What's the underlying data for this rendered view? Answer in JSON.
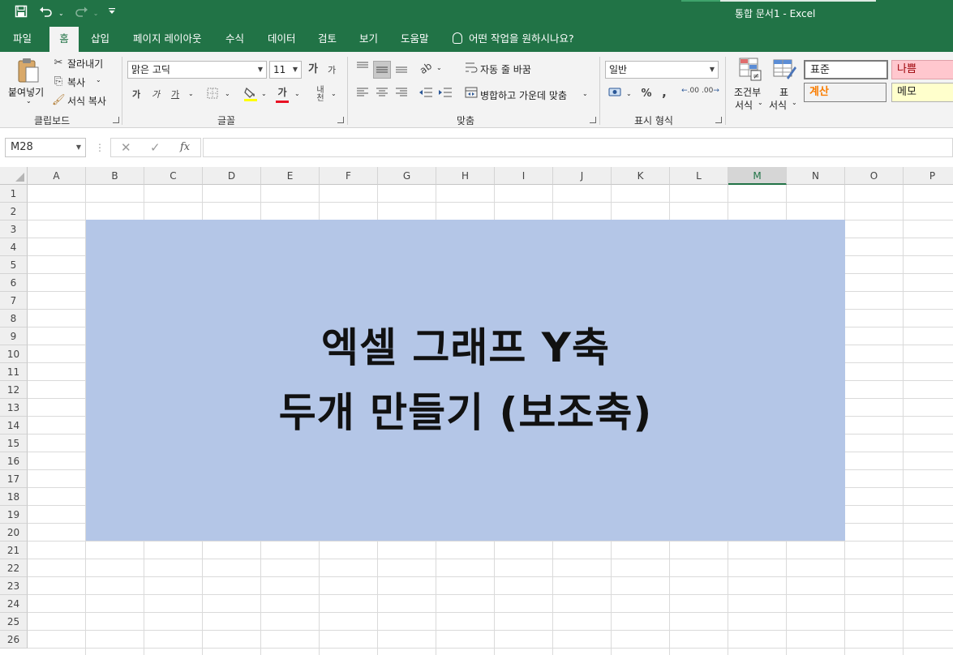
{
  "titlebar": {
    "title": "통합 문서1  -  Excel",
    "qat": {
      "save_icon": "save-icon",
      "undo_icon": "undo-icon",
      "redo_icon": "redo-icon",
      "customize_icon": "customize-qat-icon"
    }
  },
  "tabs": [
    "파일",
    "홈",
    "삽입",
    "페이지 레이아웃",
    "수식",
    "데이터",
    "검토",
    "보기",
    "도움말"
  ],
  "active_tab": "홈",
  "tell_me": "어떤 작업을 원하시나요?",
  "ribbon": {
    "clipboard": {
      "label": "클립보드",
      "paste": "붙여넣기",
      "cut": "잘라내기",
      "copy": "복사",
      "format_painter": "서식 복사"
    },
    "font": {
      "label": "글꼴",
      "font_name": "맑은 고딕",
      "font_size": "11",
      "grow": "가",
      "shrink": "가",
      "bold": "가",
      "italic": "가",
      "underline": "가",
      "font_color_letter": "가",
      "phonetic": "내천"
    },
    "alignment": {
      "label": "맞춤",
      "wrap_text": "자동 줄 바꿈",
      "merge_center": "병합하고 가운데 맞춤"
    },
    "number": {
      "label": "표시 형식",
      "format": "일반",
      "percent": "%",
      "comma": ",",
      "inc_decimal": ".00",
      "dec_decimal": ".00"
    },
    "styles": {
      "conditional_format_line1": "조건부",
      "conditional_format_line2": "서식",
      "table_format_line1": "표",
      "table_format_line2": "서식",
      "normal": "표준",
      "bad": "나쁨",
      "calculation": "계산",
      "note": "메모"
    }
  },
  "formula_bar": {
    "name_box": "M28",
    "cancel": "✕",
    "enter": "✓",
    "fx": "fx",
    "value": ""
  },
  "sheet": {
    "columns": [
      "A",
      "B",
      "C",
      "D",
      "E",
      "F",
      "G",
      "H",
      "I",
      "J",
      "K",
      "L",
      "M",
      "N",
      "O",
      "P"
    ],
    "selected_column": "M",
    "rows": [
      "1",
      "2",
      "3",
      "4",
      "5",
      "6",
      "7",
      "8",
      "9",
      "10",
      "11",
      "12",
      "13",
      "14",
      "15",
      "16",
      "17",
      "18",
      "19",
      "20",
      "21",
      "22",
      "23",
      "24",
      "25",
      "26"
    ],
    "banner": {
      "line1": "엑셀 그래프 Y축",
      "line2": "두개 만들기 (보조축)",
      "fill_color": "#b4c6e7"
    }
  },
  "colors": {
    "excel_green": "#217346",
    "style_bad_bg": "#ffc7ce",
    "style_bad_text": "#9c0006",
    "style_calc_bg": "#f2f2f2",
    "style_calc_text": "#fa7d00",
    "style_note_bg": "#ffffcc"
  }
}
